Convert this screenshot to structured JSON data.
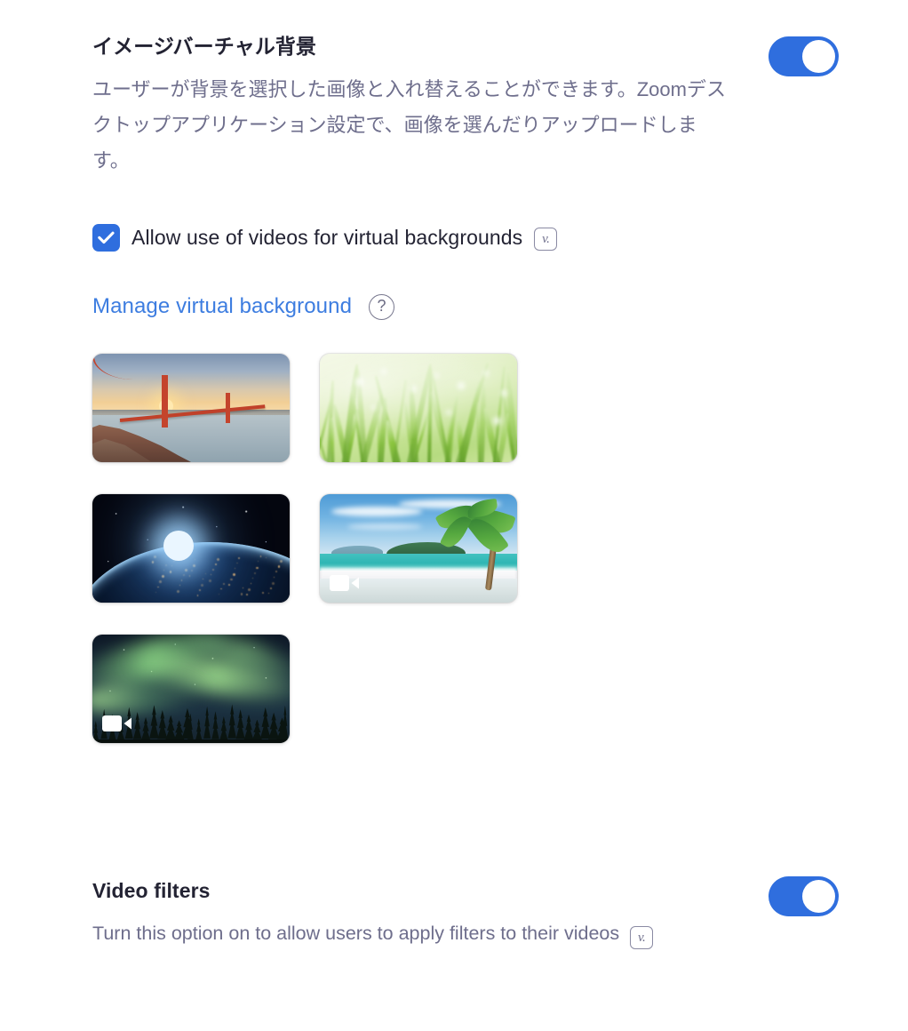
{
  "virtual_background": {
    "title": "イメージバーチャル背景",
    "description": "ユーザーが背景を選択した画像と入れ替えることができます。Zoomデスクトップアプリケーション設定で、画像を選んだりアップロードします。",
    "toggle": {
      "name": "virtual-background-toggle",
      "state": "on"
    },
    "checkbox": {
      "label": "Allow use of videos for virtual backgrounds",
      "checked": true,
      "badge": "v."
    },
    "manage_link": "Manage virtual background",
    "help_icon": "?",
    "thumbnails": [
      {
        "name": "golden-gate-bridge",
        "alt": "Golden Gate Bridge at sunset",
        "has_video_badge": false
      },
      {
        "name": "green-grass",
        "alt": "Dewy green grass close-up",
        "has_video_badge": false
      },
      {
        "name": "earth-from-space",
        "alt": "Earth from space at night",
        "has_video_badge": false
      },
      {
        "name": "tropical-beach",
        "alt": "Tropical beach with palm tree",
        "has_video_badge": true
      },
      {
        "name": "aurora-borealis",
        "alt": "Aurora borealis over pine forest",
        "has_video_badge": true
      }
    ]
  },
  "video_filters": {
    "title": "Video filters",
    "description": "Turn this option on to allow users to apply filters to their videos",
    "badge": "v.",
    "toggle": {
      "name": "video-filters-toggle",
      "state": "on"
    }
  },
  "colors": {
    "accent_blue": "#2f6ede",
    "link_blue": "#3d7de0",
    "title_text": "#232333",
    "muted_text": "#6e6e8c",
    "background": "#ffffff"
  }
}
